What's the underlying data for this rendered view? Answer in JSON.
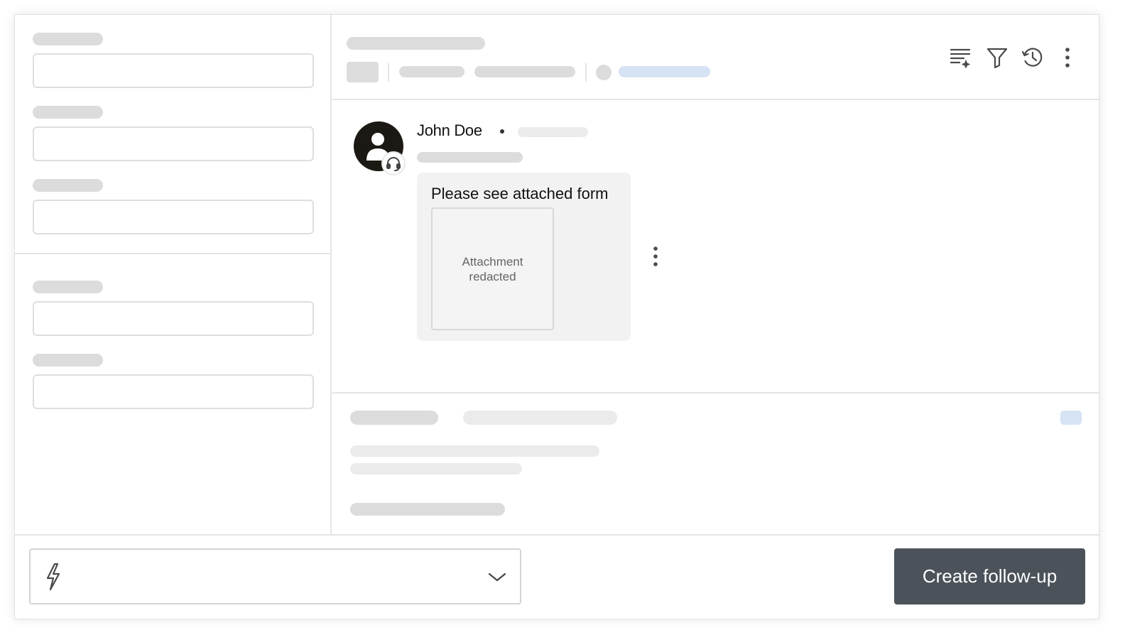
{
  "message": {
    "author": "John Doe",
    "text": "Please see attached form",
    "attachment_label": "Attachment redacted",
    "author_icon": "person-icon",
    "badge_icon": "headset-icon"
  },
  "header": {
    "icons": [
      "text-sparkle-icon",
      "filter-icon",
      "history-icon",
      "more-vertical-icon"
    ]
  },
  "footer": {
    "macro_icon": "lightning-bolt-icon",
    "macro_dropdown_icon": "chevron-down-icon",
    "primary_button_label": "Create follow-up"
  },
  "colors": {
    "primary_button": "#4b525a",
    "avatar_bg": "#1c1914",
    "skeleton": "#dcdcdc",
    "skeleton_accent": "#d6e3f5"
  }
}
